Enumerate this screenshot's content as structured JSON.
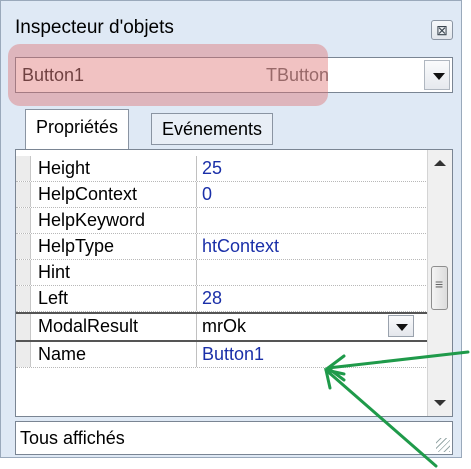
{
  "window": {
    "title": "Inspecteur d'objets",
    "close_glyph": "⊠"
  },
  "component_selector": {
    "name": "Button1",
    "type": "TButton"
  },
  "tabs": [
    {
      "label": "Propriétés"
    },
    {
      "label": "Evénements"
    }
  ],
  "properties": [
    {
      "name": "Height",
      "value": "25"
    },
    {
      "name": "HelpContext",
      "value": "0"
    },
    {
      "name": "HelpKeyword",
      "value": ""
    },
    {
      "name": "HelpType",
      "value": "htContext"
    },
    {
      "name": "Hint",
      "value": ""
    },
    {
      "name": "Left",
      "value": "28"
    },
    {
      "name": "ModalResult",
      "value": "mrOk"
    },
    {
      "name": "Name",
      "value": "Button1"
    }
  ],
  "status": {
    "text": "Tous affichés"
  },
  "colors": {
    "highlight": "#de6e6e",
    "arrow": "#1f9a4a",
    "value_text": "#1a2fa8"
  }
}
